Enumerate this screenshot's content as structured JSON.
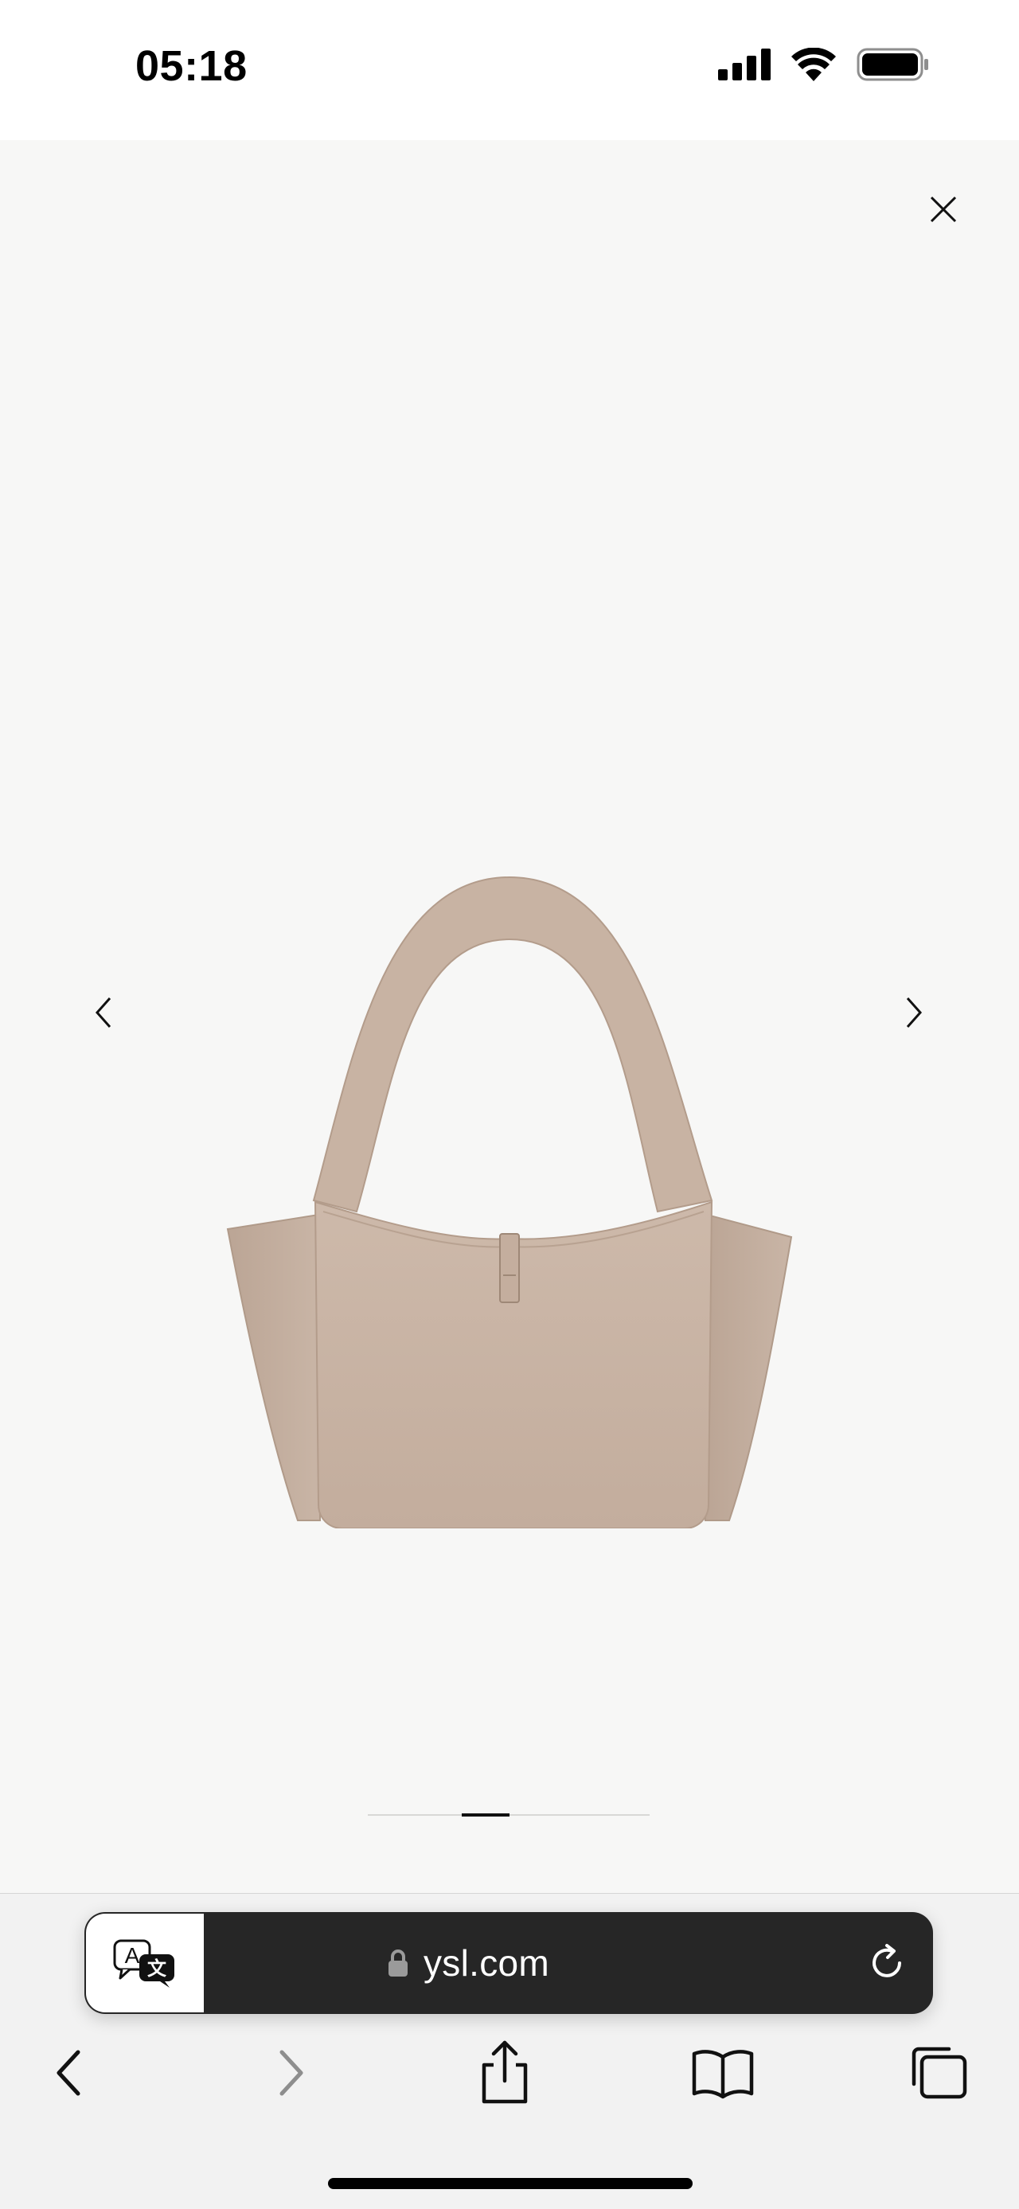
{
  "status_bar": {
    "time": "05:18",
    "icons": [
      "signal-icon",
      "wifi-icon",
      "battery-icon"
    ]
  },
  "gallery": {
    "close_icon": "close-icon",
    "prev_icon": "chevron-left-icon",
    "next_icon": "chevron-right-icon",
    "image_alt": "Beige leather tote bag",
    "pager": {
      "total_segments": 3,
      "active_index": 1
    }
  },
  "address_bar": {
    "translate_icon": "translate-icon",
    "lock_icon": "lock-icon",
    "url": "ysl.com",
    "reload_icon": "reload-icon"
  },
  "toolbar": {
    "items": [
      "back-icon",
      "forward-icon",
      "share-icon",
      "bookmarks-icon",
      "tabs-icon"
    ]
  },
  "colors": {
    "gallery_bg": "#f7f7f6",
    "bag": "#cbb7a8",
    "address_bar_bg": "#262626"
  }
}
